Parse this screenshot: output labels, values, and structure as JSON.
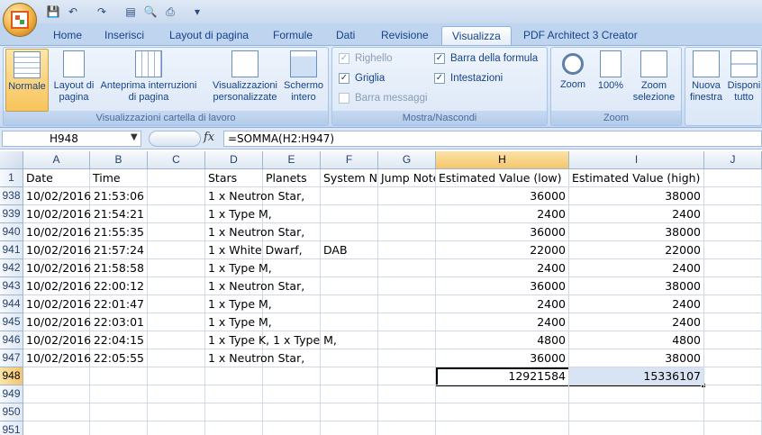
{
  "qat": {
    "menu_arrow": "▾"
  },
  "tabs": [
    "Home",
    "Inserisci",
    "Layout di pagina",
    "Formule",
    "Dati",
    "Revisione",
    "Visualizza",
    "PDF Architect 3 Creator"
  ],
  "active_tab": "Visualizza",
  "ribbon": {
    "group1": {
      "label": "Visualizzazioni cartella di lavoro",
      "buttons": [
        "Normale",
        "Layout di pagina",
        "Anteprima interruzioni di pagina",
        "Visualizzazioni personalizzate",
        "Schermo intero"
      ]
    },
    "group2": {
      "label": "Mostra/Nascondi",
      "checks": [
        {
          "label": "Righello",
          "checked": true,
          "disabled": true
        },
        {
          "label": "Barra della formula",
          "checked": true,
          "disabled": false
        },
        {
          "label": "Griglia",
          "checked": true,
          "disabled": false
        },
        {
          "label": "Intestazioni",
          "checked": true,
          "disabled": false
        },
        {
          "label": "Barra messaggi",
          "checked": false,
          "disabled": true
        }
      ]
    },
    "group3": {
      "label": "Zoom",
      "buttons": [
        "Zoom",
        "100%",
        "Zoom selezione"
      ]
    },
    "group4": {
      "buttons": [
        "Nuova finestra",
        "Disponi tutto"
      ]
    }
  },
  "formula_bar": {
    "name_box": "H948",
    "fx": "fx",
    "formula": "=SOMMA(H2:H947)"
  },
  "columns": [
    "A",
    "B",
    "C",
    "D",
    "E",
    "F",
    "G",
    "H",
    "I",
    "J"
  ],
  "header_row": {
    "row": "1",
    "cells": [
      "Date",
      "Time",
      "",
      "Stars",
      "Planets",
      "System No",
      "Jump Note",
      "Estimated Value (low)",
      "Estimated Value (high)",
      ""
    ]
  },
  "rows": [
    {
      "row": "938",
      "cells": [
        "10/02/2016",
        "21:53:06",
        "",
        "1 x Neutron Star,",
        "",
        "",
        "",
        "36000",
        "38000",
        ""
      ]
    },
    {
      "row": "939",
      "cells": [
        "10/02/2016",
        "21:54:21",
        "",
        "1 x Type M,",
        "",
        "",
        "",
        "2400",
        "2400",
        ""
      ]
    },
    {
      "row": "940",
      "cells": [
        "10/02/2016",
        "21:55:35",
        "",
        "1 x Neutron Star,",
        "",
        "",
        "",
        "36000",
        "38000",
        ""
      ]
    },
    {
      "row": "941",
      "cells": [
        "10/02/2016",
        "21:57:24",
        "",
        "1 x White Dwarf,",
        "",
        "DAB",
        "",
        "22000",
        "22000",
        ""
      ]
    },
    {
      "row": "942",
      "cells": [
        "10/02/2016",
        "21:58:58",
        "",
        "1 x Type M,",
        "",
        "",
        "",
        "2400",
        "2400",
        ""
      ]
    },
    {
      "row": "943",
      "cells": [
        "10/02/2016",
        "22:00:12",
        "",
        "1 x Neutron Star,",
        "",
        "",
        "",
        "36000",
        "38000",
        ""
      ]
    },
    {
      "row": "944",
      "cells": [
        "10/02/2016",
        "22:01:47",
        "",
        "1 x Type M,",
        "",
        "",
        "",
        "2400",
        "2400",
        ""
      ]
    },
    {
      "row": "945",
      "cells": [
        "10/02/2016",
        "22:03:01",
        "",
        "1 x Type M,",
        "",
        "",
        "",
        "2400",
        "2400",
        ""
      ]
    },
    {
      "row": "946",
      "cells": [
        "10/02/2016",
        "22:04:15",
        "",
        "1 x Type K, 1 x Type M,",
        "",
        "",
        "",
        "4800",
        "4800",
        ""
      ]
    },
    {
      "row": "947",
      "cells": [
        "10/02/2016",
        "22:05:55",
        "",
        "1 x Neutron Star,",
        "",
        "",
        "",
        "36000",
        "38000",
        ""
      ]
    },
    {
      "row": "948",
      "cells": [
        "",
        "",
        "",
        "",
        "",
        "",
        "",
        "12921584",
        "15336107",
        ""
      ]
    },
    {
      "row": "949",
      "cells": [
        "",
        "",
        "",
        "",
        "",
        "",
        "",
        "",
        "",
        ""
      ]
    },
    {
      "row": "950",
      "cells": [
        "",
        "",
        "",
        "",
        "",
        "",
        "",
        "",
        "",
        ""
      ]
    },
    {
      "row": "951",
      "cells": [
        "",
        "",
        "",
        "",
        "",
        "",
        "",
        "",
        "",
        ""
      ]
    }
  ],
  "selected_cell": {
    "row": "948",
    "column": "H"
  },
  "colors": {
    "accent": "#15428b",
    "selection_header": "#f5c56a"
  }
}
